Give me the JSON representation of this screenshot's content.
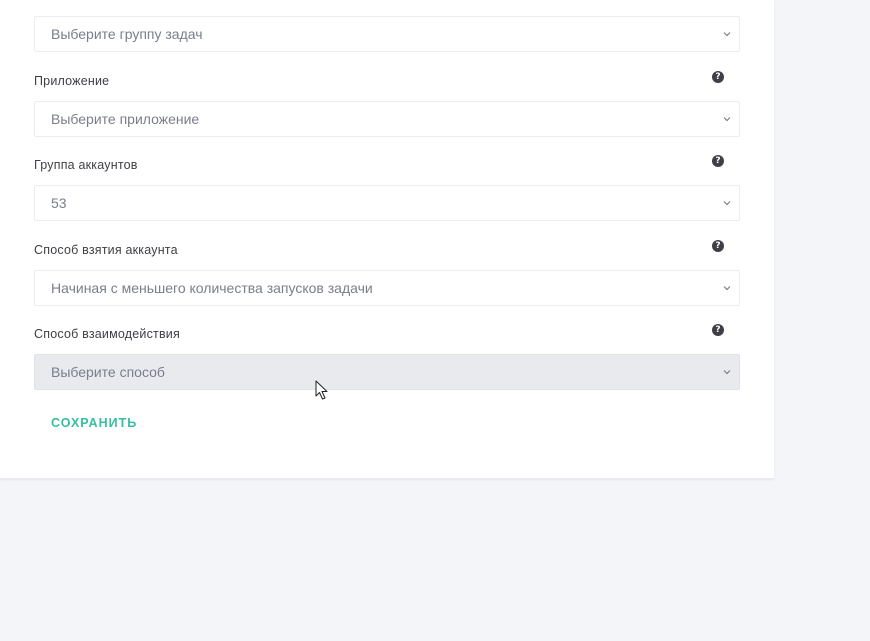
{
  "form": {
    "task_group": {
      "placeholder": "Выберите группу задач"
    },
    "application": {
      "label": "Приложение",
      "placeholder": "Выберите приложение",
      "help_icon": "question-circle-icon"
    },
    "account_group": {
      "label": "Группа аккаунтов",
      "value": "53",
      "help_icon": "question-circle-icon"
    },
    "account_method": {
      "label": "Способ взятия аккаунта",
      "value": "Начиная с меньшего количества запусков задачи",
      "help_icon": "question-circle-icon"
    },
    "interaction_method": {
      "label": "Способ взаимодействия",
      "placeholder": "Выберите способ",
      "help_icon": "question-circle-icon",
      "disabled": true
    },
    "save_label": "СОХРАНИТЬ"
  },
  "colors": {
    "page_background": "#f4f5f9",
    "card_background": "#ffffff",
    "accent": "#34bfa3",
    "label_text": "#3f4047",
    "value_text": "#7b7e8a",
    "disabled_background": "#e8eaee"
  }
}
